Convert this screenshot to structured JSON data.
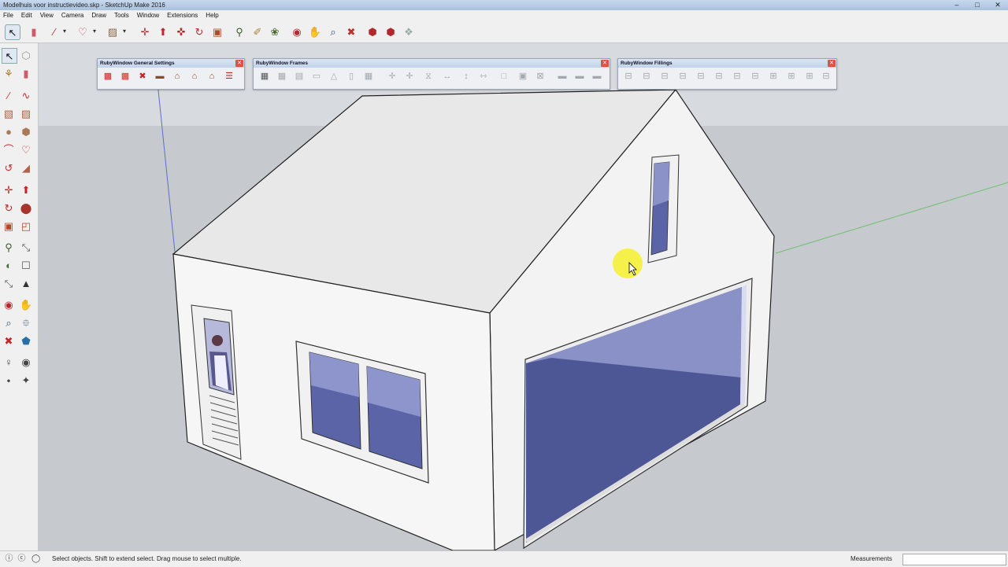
{
  "window": {
    "title": "Modelhuis voor instructievideo.skp - SketchUp Make 2016",
    "controls": [
      "–",
      "□",
      "✕"
    ]
  },
  "menu": [
    "File",
    "Edit",
    "View",
    "Camera",
    "Draw",
    "Tools",
    "Window",
    "Extensions",
    "Help"
  ],
  "palettes": {
    "general": {
      "title": "RubyWindow General Settings"
    },
    "frames": {
      "title": "RubyWindow Frames"
    },
    "fillings": {
      "title": "RubyWindow Fillings"
    }
  },
  "status": {
    "hint": "Select objects. Shift to extend select. Drag mouse to select multiple.",
    "measurements_label": "Measurements",
    "measurements_value": ""
  },
  "colors": {
    "sky": "#cfd3d8",
    "ground": "#c5c8cd",
    "wall": "#f4f4f4",
    "roof": "#e9e9e9",
    "glass": "#4e5796",
    "glass_light": "#8b93c9",
    "cursor_highlight": "#f6ee2b"
  },
  "icons": {
    "toolbar": [
      "select-arrow-icon",
      "eraser-icon",
      "line-pencil-icon",
      "dropdown-icon",
      "freehand-icon",
      "dropdown-icon",
      "paint-bucket-icon",
      "dropdown-icon",
      "move-icon",
      "push-pull-icon",
      "rotate-icon",
      "follow-me-icon",
      "scale-icon",
      "offset-icon",
      "tape-measure-icon",
      "text-icon",
      "axes-icon",
      "orbit-icon",
      "pan-icon",
      "zoom-icon",
      "zoom-extents-icon",
      "3d-warehouse-icon",
      "extension-warehouse-icon",
      "components-icon"
    ],
    "left": [
      "select-icon",
      "component-icon",
      "paint-bucket-icon",
      "eraser-icon",
      "line-icon",
      "freehand-icon",
      "rectangle-icon",
      "rotated-rectangle-icon",
      "circle-icon",
      "polygon-icon",
      "arc-icon",
      "two-point-arc-icon",
      "three-point-arc-icon",
      "pie-icon",
      "move-icon",
      "push-pull-icon",
      "rotate-icon",
      "follow-me-icon",
      "scale-icon",
      "offset-icon",
      "tape-measure-icon",
      "dimension-icon",
      "protractor-icon",
      "text-icon",
      "axes-icon",
      "3d-text-icon",
      "orbit-icon",
      "pan-icon",
      "zoom-icon",
      "zoom-window-icon",
      "zoom-extents-icon",
      "position-camera-icon",
      "walk-icon",
      "look-around-icon",
      "section-plane-icon",
      "section-display-icon"
    ]
  }
}
